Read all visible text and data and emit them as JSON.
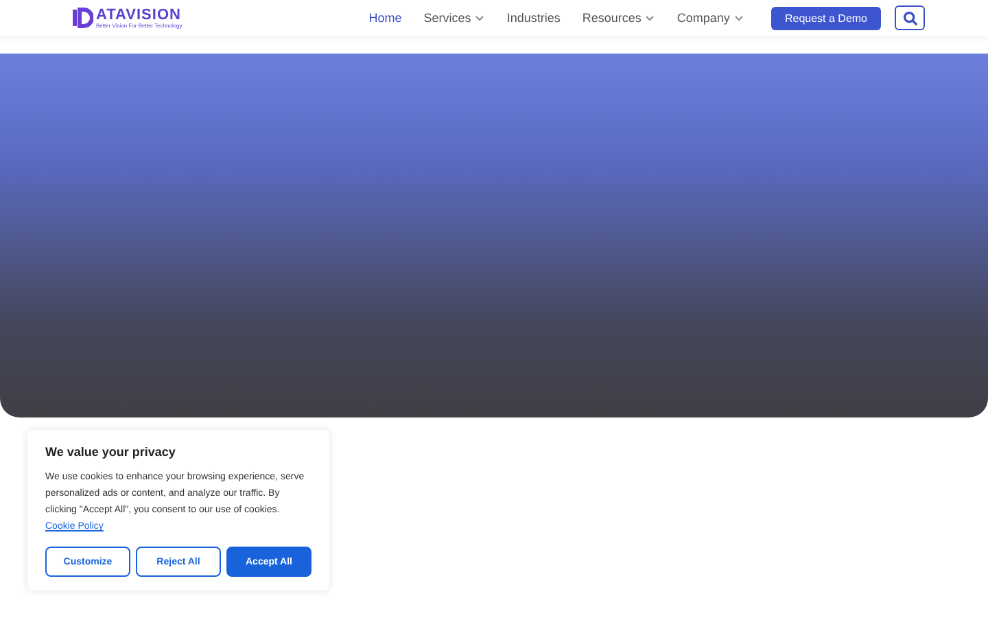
{
  "header": {
    "logo": {
      "name": "ATAVISION",
      "tagline": "Better Vision For Better Technology"
    },
    "nav": [
      {
        "label": "Home",
        "selected": true,
        "dropdown": false
      },
      {
        "label": "Services",
        "selected": false,
        "dropdown": true
      },
      {
        "label": "Industries",
        "selected": false,
        "dropdown": false
      },
      {
        "label": "Resources",
        "selected": false,
        "dropdown": true
      },
      {
        "label": "Company",
        "selected": false,
        "dropdown": true
      }
    ],
    "cta": "Request a Demo"
  },
  "cookie_banner": {
    "title": "We value your privacy",
    "text": "We use cookies to enhance your browsing experience, serve personalized ads or content, and analyze our traffic. By clicking \"Accept All\", you consent to our use of cookies.",
    "link": "Cookie Policy",
    "buttons": [
      {
        "label": "Customize",
        "kind": "outline"
      },
      {
        "label": "Reject All",
        "kind": "outline"
      },
      {
        "label": "Accept All",
        "kind": "primary"
      }
    ]
  }
}
